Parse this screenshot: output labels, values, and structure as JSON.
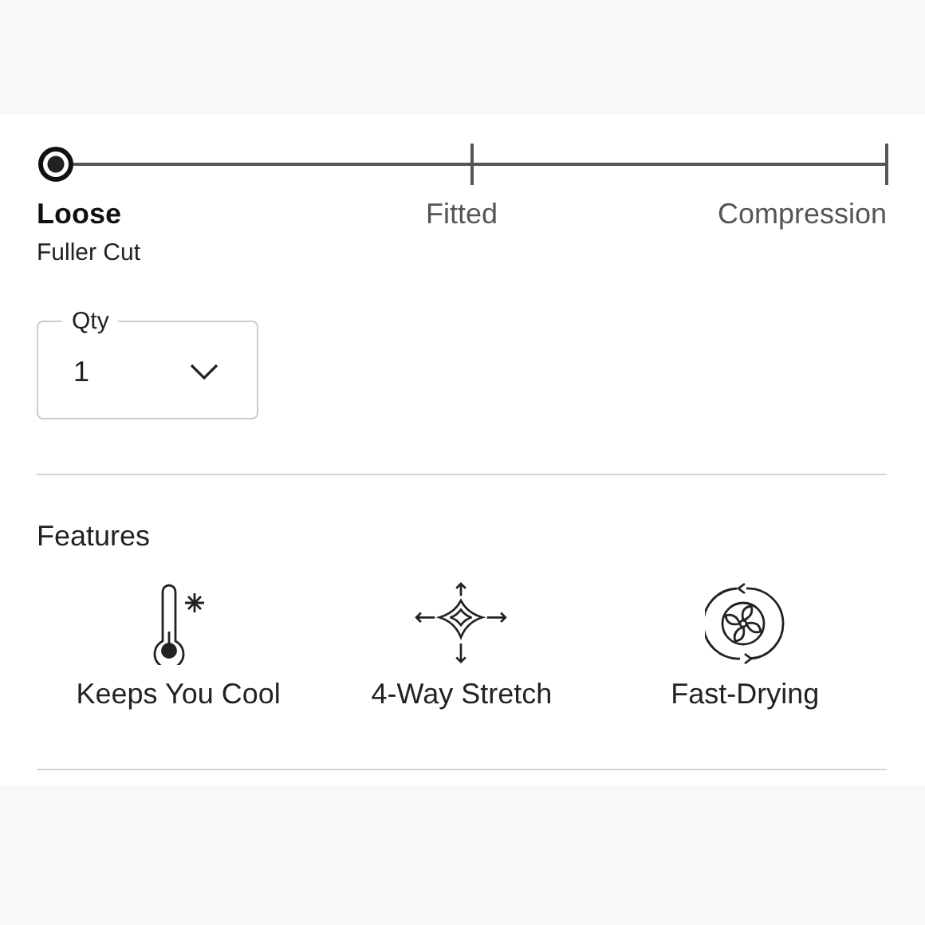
{
  "fit": {
    "options": [
      {
        "label": "Loose",
        "note": "Fuller Cut",
        "selected": true
      },
      {
        "label": "Fitted",
        "selected": false
      },
      {
        "label": "Compression",
        "selected": false
      }
    ]
  },
  "quantity": {
    "label": "Qty",
    "value": "1"
  },
  "features": {
    "title": "Features",
    "items": [
      {
        "kind": "cool",
        "label": "Keeps You Cool"
      },
      {
        "kind": "stretch",
        "label": "4-Way Stretch"
      },
      {
        "kind": "drying",
        "label": "Fast-Drying"
      }
    ]
  }
}
